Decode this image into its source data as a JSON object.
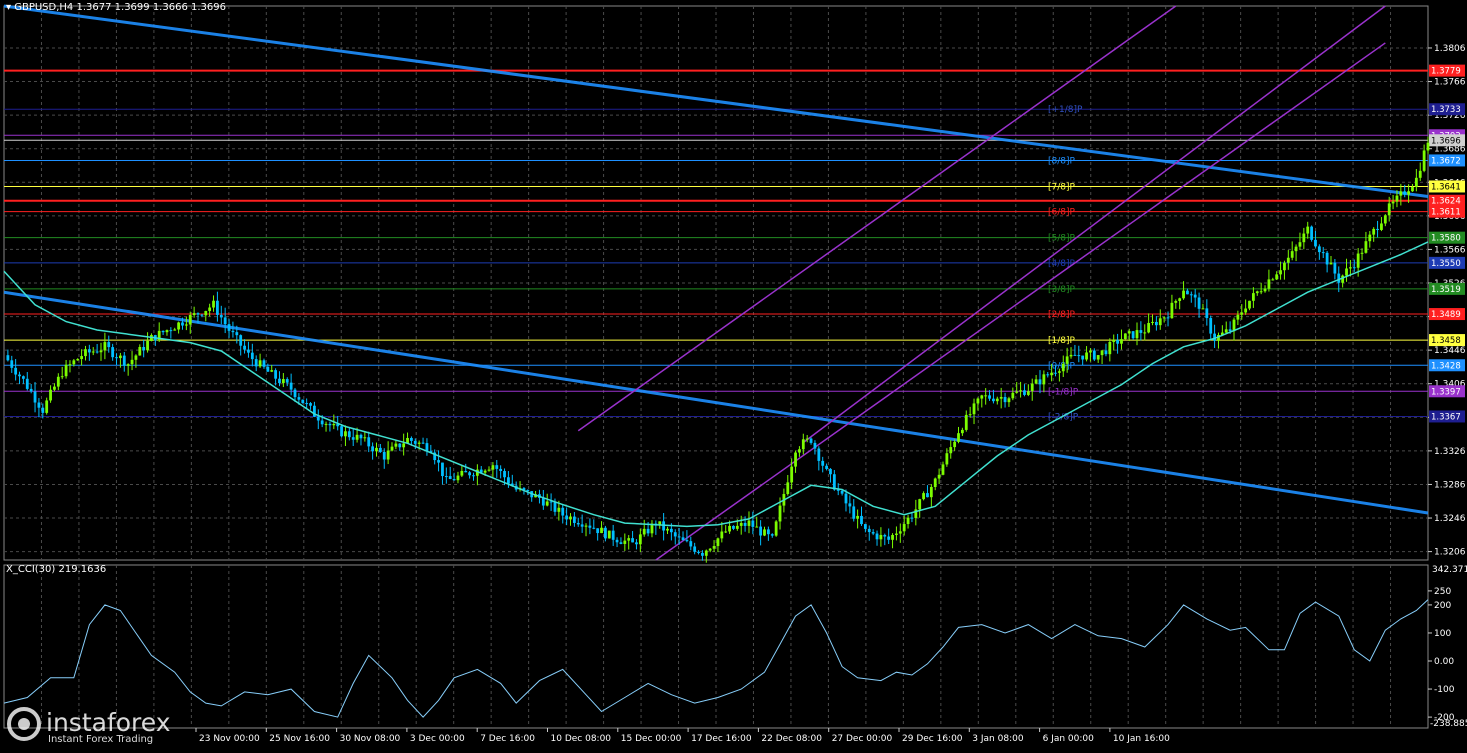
{
  "header": {
    "symbol_label": "GBPUSD,H4",
    "ohlc": "1.3677 1.3699 1.3666 1.3696"
  },
  "indicator": {
    "label": "X_CCI(30) 219.1636",
    "scale_top": "342.3711",
    "scale_bottom": "-238.885",
    "ticks": [
      "250",
      "200",
      "100",
      "0.00",
      "-100",
      "-200"
    ]
  },
  "logo": {
    "name": "instaforex",
    "tagline": "Instant Forex Trading",
    "icon": "instaforex-logo-icon"
  },
  "colors": {
    "background": "#000000",
    "grid": "#4a4a4a",
    "bull": "#7cfc00",
    "bear": "#00bfff",
    "ma": "#40e0d0",
    "trend": "#1e90ff",
    "channel": "#9932cc",
    "cci": "#87cefa"
  },
  "price_axis": {
    "ticks": [
      "1.3806",
      "1.3766",
      "1.3726",
      "1.3686",
      "1.3646",
      "1.3606",
      "1.3566",
      "1.3526",
      "1.3486",
      "1.3446",
      "1.3406",
      "1.3366",
      "1.3326",
      "1.3286",
      "1.3246",
      "1.3206"
    ],
    "current": "1.3696"
  },
  "time_axis": [
    "23 Nov 00:00",
    "25 Nov 16:00",
    "30 Nov 08:00",
    "3 Dec 00:00",
    "7 Dec 16:00",
    "10 Dec 08:00",
    "15 Dec 00:00",
    "17 Dec 16:00",
    "22 Dec 08:00",
    "27 Dec 00:00",
    "29 Dec 16:00",
    "3 Jan 08:00",
    "6 Jan 00:00",
    "10 Jan 16:00"
  ],
  "levels": [
    {
      "name": "+2/8",
      "price": 1.3779,
      "label": "1.3779",
      "color": "#ff2020",
      "murrey": ""
    },
    {
      "name": "+1/8",
      "price": 1.3733,
      "label": "1.3733",
      "color": "#1e1e90",
      "murrey": "[+1/8]P"
    },
    {
      "name": "8/8",
      "price": 1.3702,
      "label": "1.3702",
      "color": "#9932cc",
      "murrey": ""
    },
    {
      "name": "high",
      "price": 1.3696,
      "label": "1.3696",
      "color": "#d0d0d0",
      "murrey": ""
    },
    {
      "name": "8/8b",
      "price": 1.3672,
      "label": "1.3672",
      "color": "#1e90ff",
      "murrey": "[8/8]P"
    },
    {
      "name": "7/8",
      "price": 1.3641,
      "label": "1.3641",
      "color": "#ffff40",
      "murrey": "[7/8]P"
    },
    {
      "name": "r1",
      "price": 1.3624,
      "label": "1.3624",
      "color": "#ff2020",
      "murrey": ""
    },
    {
      "name": "6/8",
      "price": 1.3611,
      "label": "1.3611",
      "color": "#ff2020",
      "murrey": "[6/8]P"
    },
    {
      "name": "5/8",
      "price": 1.358,
      "label": "1.3580",
      "color": "#228b22",
      "murrey": "[5/8]P"
    },
    {
      "name": "4/8",
      "price": 1.355,
      "label": "1.3550",
      "color": "#1e3cb4",
      "murrey": "[4/8]P"
    },
    {
      "name": "3/8",
      "price": 1.3519,
      "label": "1.3519",
      "color": "#228b22",
      "murrey": "[3/8]P"
    },
    {
      "name": "2/8",
      "price": 1.3489,
      "label": "1.3489",
      "color": "#ff2020",
      "murrey": "[2/8]P"
    },
    {
      "name": "1/8",
      "price": 1.3458,
      "label": "1.3458",
      "color": "#ffff40",
      "murrey": "[1/8]P"
    },
    {
      "name": "0/8",
      "price": 1.3428,
      "label": "1.3428",
      "color": "#1e90ff",
      "murrey": "[0/8]P"
    },
    {
      "name": "-1/8",
      "price": 1.3397,
      "label": "1.3397",
      "color": "#9932cc",
      "murrey": "[-1/8]P"
    },
    {
      "name": "-2/8",
      "price": 1.3367,
      "label": "1.3367",
      "color": "#1e1e90",
      "murrey": "[-2/8]P"
    }
  ],
  "chart_data": {
    "type": "candlestick",
    "symbol": "GBPUSD",
    "timeframe": "H4",
    "ylim": [
      1.3196,
      1.3856
    ],
    "x_categories": [
      "23 Nov 00:00",
      "25 Nov 16:00",
      "30 Nov 08:00",
      "3 Dec 00:00",
      "7 Dec 16:00",
      "10 Dec 08:00",
      "15 Dec 00:00",
      "17 Dec 16:00",
      "22 Dec 08:00",
      "27 Dec 00:00",
      "29 Dec 16:00",
      "3 Jan 08:00",
      "6 Jan 00:00",
      "10 Jan 16:00"
    ],
    "close_path": [
      [
        0,
        1.344
      ],
      [
        5,
        1.341
      ],
      [
        10,
        1.3375
      ],
      [
        15,
        1.342
      ],
      [
        20,
        1.344
      ],
      [
        26,
        1.345
      ],
      [
        32,
        1.343
      ],
      [
        38,
        1.346
      ],
      [
        44,
        1.3475
      ],
      [
        50,
        1.349
      ],
      [
        54,
        1.35
      ],
      [
        58,
        1.347
      ],
      [
        63,
        1.344
      ],
      [
        68,
        1.342
      ],
      [
        74,
        1.34
      ],
      [
        80,
        1.337
      ],
      [
        86,
        1.335
      ],
      [
        92,
        1.334
      ],
      [
        98,
        1.332
      ],
      [
        104,
        1.334
      ],
      [
        110,
        1.333
      ],
      [
        114,
        1.329
      ],
      [
        120,
        1.33
      ],
      [
        126,
        1.331
      ],
      [
        132,
        1.328
      ],
      [
        138,
        1.327
      ],
      [
        144,
        1.325
      ],
      [
        150,
        1.324
      ],
      [
        156,
        1.3225
      ],
      [
        162,
        1.3215
      ],
      [
        168,
        1.324
      ],
      [
        174,
        1.322
      ],
      [
        180,
        1.3205
      ],
      [
        186,
        1.323
      ],
      [
        192,
        1.324
      ],
      [
        198,
        1.322
      ],
      [
        204,
        1.333
      ],
      [
        208,
        1.334
      ],
      [
        212,
        1.33
      ],
      [
        216,
        1.327
      ],
      [
        222,
        1.323
      ],
      [
        228,
        1.322
      ],
      [
        234,
        1.325
      ],
      [
        240,
        1.329
      ],
      [
        246,
        1.335
      ],
      [
        252,
        1.339
      ],
      [
        258,
        1.339
      ],
      [
        264,
        1.34
      ],
      [
        270,
        1.342
      ],
      [
        276,
        1.344
      ],
      [
        282,
        1.344
      ],
      [
        288,
        1.346
      ],
      [
        294,
        1.347
      ],
      [
        300,
        1.349
      ],
      [
        304,
        1.352
      ],
      [
        308,
        1.35
      ],
      [
        312,
        1.346
      ],
      [
        316,
        1.347
      ],
      [
        320,
        1.35
      ],
      [
        324,
        1.352
      ],
      [
        328,
        1.354
      ],
      [
        332,
        1.356
      ],
      [
        336,
        1.359
      ],
      [
        340,
        1.356
      ],
      [
        344,
        1.353
      ],
      [
        348,
        1.355
      ],
      [
        352,
        1.358
      ],
      [
        356,
        1.361
      ],
      [
        360,
        1.363
      ],
      [
        364,
        1.365
      ],
      [
        367,
        1.3696
      ]
    ],
    "ma_path": [
      [
        0,
        1.354
      ],
      [
        8,
        1.35
      ],
      [
        16,
        1.348
      ],
      [
        24,
        1.347
      ],
      [
        32,
        1.3465
      ],
      [
        40,
        1.346
      ],
      [
        48,
        1.3455
      ],
      [
        56,
        1.3445
      ],
      [
        64,
        1.342
      ],
      [
        72,
        1.3395
      ],
      [
        80,
        1.337
      ],
      [
        88,
        1.3355
      ],
      [
        96,
        1.3345
      ],
      [
        104,
        1.3335
      ],
      [
        112,
        1.332
      ],
      [
        120,
        1.3305
      ],
      [
        128,
        1.329
      ],
      [
        136,
        1.3275
      ],
      [
        144,
        1.3262
      ],
      [
        152,
        1.325
      ],
      [
        160,
        1.324
      ],
      [
        168,
        1.3238
      ],
      [
        176,
        1.3236
      ],
      [
        184,
        1.3238
      ],
      [
        192,
        1.3245
      ],
      [
        200,
        1.3265
      ],
      [
        208,
        1.3285
      ],
      [
        216,
        1.328
      ],
      [
        224,
        1.326
      ],
      [
        232,
        1.325
      ],
      [
        240,
        1.326
      ],
      [
        248,
        1.329
      ],
      [
        256,
        1.332
      ],
      [
        264,
        1.3345
      ],
      [
        272,
        1.3365
      ],
      [
        280,
        1.3385
      ],
      [
        288,
        1.3405
      ],
      [
        296,
        1.343
      ],
      [
        304,
        1.345
      ],
      [
        312,
        1.346
      ],
      [
        320,
        1.3475
      ],
      [
        328,
        1.3495
      ],
      [
        336,
        1.3515
      ],
      [
        344,
        1.353
      ],
      [
        352,
        1.3545
      ],
      [
        360,
        1.356
      ],
      [
        367,
        1.3575
      ]
    ],
    "trend_lines": [
      {
        "name": "upper-trendline",
        "from": [
          0,
          1.3856
        ],
        "to": [
          367,
          1.3629
        ]
      },
      {
        "name": "lower-trendline",
        "from": [
          0,
          1.3515
        ],
        "to": [
          367,
          1.3252
        ]
      }
    ],
    "channel_lines": [
      {
        "name": "channel-top",
        "from": [
          148,
          1.335
        ],
        "to": [
          302,
          1.3856
        ]
      },
      {
        "name": "channel-mid",
        "from": [
          206,
          1.3336
        ],
        "to": [
          356,
          1.3856
        ]
      },
      {
        "name": "channel-bottom",
        "from": [
          168,
          1.3196
        ],
        "to": [
          356,
          1.3812
        ]
      }
    ],
    "cci_ylim": [
      -238.885,
      342.3711
    ],
    "cci_path": [
      [
        0,
        -150
      ],
      [
        6,
        -130
      ],
      [
        12,
        -60
      ],
      [
        18,
        -60
      ],
      [
        22,
        130
      ],
      [
        26,
        200
      ],
      [
        30,
        180
      ],
      [
        34,
        100
      ],
      [
        38,
        20
      ],
      [
        44,
        -40
      ],
      [
        48,
        -110
      ],
      [
        52,
        -150
      ],
      [
        56,
        -160
      ],
      [
        62,
        -110
      ],
      [
        68,
        -120
      ],
      [
        74,
        -100
      ],
      [
        80,
        -180
      ],
      [
        86,
        -200
      ],
      [
        90,
        -80
      ],
      [
        94,
        20
      ],
      [
        100,
        -60
      ],
      [
        104,
        -140
      ],
      [
        108,
        -200
      ],
      [
        112,
        -140
      ],
      [
        116,
        -60
      ],
      [
        122,
        -30
      ],
      [
        128,
        -80
      ],
      [
        132,
        -150
      ],
      [
        138,
        -70
      ],
      [
        144,
        -30
      ],
      [
        150,
        -120
      ],
      [
        154,
        -180
      ],
      [
        160,
        -130
      ],
      [
        166,
        -80
      ],
      [
        172,
        -120
      ],
      [
        178,
        -150
      ],
      [
        184,
        -130
      ],
      [
        190,
        -100
      ],
      [
        196,
        -40
      ],
      [
        200,
        60
      ],
      [
        204,
        160
      ],
      [
        208,
        200
      ],
      [
        212,
        100
      ],
      [
        216,
        -20
      ],
      [
        220,
        -60
      ],
      [
        226,
        -70
      ],
      [
        230,
        -40
      ],
      [
        234,
        -50
      ],
      [
        238,
        -10
      ],
      [
        242,
        50
      ],
      [
        246,
        120
      ],
      [
        252,
        130
      ],
      [
        258,
        100
      ],
      [
        264,
        130
      ],
      [
        270,
        80
      ],
      [
        276,
        130
      ],
      [
        282,
        90
      ],
      [
        288,
        80
      ],
      [
        294,
        50
      ],
      [
        300,
        130
      ],
      [
        304,
        200
      ],
      [
        310,
        150
      ],
      [
        316,
        110
      ],
      [
        320,
        120
      ],
      [
        326,
        40
      ],
      [
        330,
        40
      ],
      [
        334,
        170
      ],
      [
        338,
        210
      ],
      [
        344,
        160
      ],
      [
        348,
        40
      ],
      [
        352,
        0
      ],
      [
        356,
        110
      ],
      [
        360,
        150
      ],
      [
        364,
        180
      ],
      [
        367,
        219
      ]
    ]
  }
}
